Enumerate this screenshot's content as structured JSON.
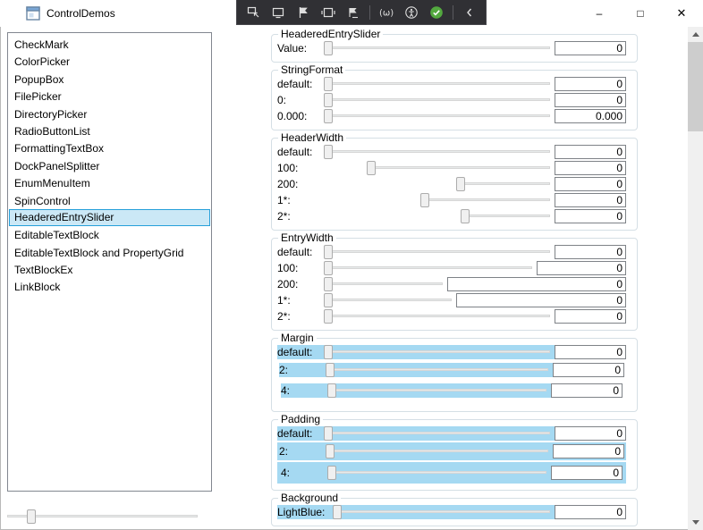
{
  "colors": {
    "selection-bg": "#CBE8F6",
    "selection-border": "#26A0DA",
    "highlight-row": "#A5D9F2",
    "group-border": "#D5DFE5",
    "entry-border": "#7E8287",
    "track-fill": "#E7EAEA",
    "track-border": "#D6D6D6",
    "thumb-fill": "#F0F0F0",
    "thumb-border": "#ACACAC",
    "toolbar-bg": "#303034",
    "toolbar-border": "#46464B",
    "toolbar-icon": "#DEDEDE",
    "status-green": "#53A93F",
    "scrollbar-bg": "#F0F0F0",
    "scrollbar-thumb": "#CDCDCD",
    "scrollbar-arrow": "#606060",
    "listbox-border": "#828790"
  },
  "window": {
    "title": "ControlDemos",
    "buttons": {
      "minimize": "–",
      "maximize": "□",
      "close": "✕"
    }
  },
  "debug_toolbar": {
    "items": [
      {
        "icon": "go-to-live-visual-tree-icon"
      },
      {
        "icon": "select-element-icon"
      },
      {
        "icon": "enable-selection-icon"
      },
      {
        "icon": "display-layout-adorners-icon"
      },
      {
        "icon": "track-focused-element-icon"
      },
      {
        "type": "separator"
      },
      {
        "icon": "hot-reload-icon"
      },
      {
        "icon": "accessibility-checker-icon"
      },
      {
        "icon": "status-ok-icon"
      },
      {
        "type": "separator"
      },
      {
        "icon": "collapse-toolbar-icon"
      }
    ]
  },
  "sidebar": {
    "items": [
      "CheckMark",
      "ColorPicker",
      "PopupBox",
      "FilePicker",
      "DirectoryPicker",
      "RadioButtonList",
      "FormattingTextBox",
      "DockPanelSplitter",
      "EnumMenuItem",
      "SpinControl",
      "HeaderedEntrySlider",
      "EditableTextBlock",
      "EditableTextBlock and PropertyGrid",
      "TextBlockEx",
      "LinkBlock"
    ],
    "selected_index": 10
  },
  "panel": {
    "groups": [
      {
        "title": "HeaderedEntrySlider",
        "rows": [
          {
            "label": "Value:",
            "value": "0"
          }
        ]
      },
      {
        "title": "StringFormat",
        "rows": [
          {
            "label": "default:",
            "value": "0"
          },
          {
            "label": "0:",
            "value": "0"
          },
          {
            "label": "0.000:",
            "value": "0.000"
          }
        ]
      },
      {
        "title": "HeaderWidth",
        "rows": [
          {
            "label": "default:",
            "value": "0"
          },
          {
            "label": "100:",
            "value": "0",
            "label_width": 100
          },
          {
            "label": "200:",
            "value": "0",
            "label_width": 200
          },
          {
            "label": "1*:",
            "value": "0",
            "label_width": 160
          },
          {
            "label": "2*:",
            "value": "0",
            "label_width": 205
          }
        ]
      },
      {
        "title": "EntryWidth",
        "rows": [
          {
            "label": "default:",
            "value": "0"
          },
          {
            "label": "100:",
            "value": "0",
            "entry_width": 100
          },
          {
            "label": "200:",
            "value": "0",
            "entry_width": 200
          },
          {
            "label": "1*:",
            "value": "0",
            "entry_width": 190
          },
          {
            "label": "2*:",
            "value": "0"
          }
        ]
      },
      {
        "title": "Margin",
        "rows": [
          {
            "label": "default:",
            "value": "0",
            "highlight": true,
            "margin": 0
          },
          {
            "label": "2:",
            "value": "0",
            "highlight": true,
            "margin": 2
          },
          {
            "label": "4:",
            "value": "0",
            "highlight": true,
            "margin": 4
          }
        ]
      },
      {
        "title": "Padding",
        "rows": [
          {
            "label": "default:",
            "value": "0",
            "highlight": true,
            "padding": 0
          },
          {
            "label": "2:",
            "value": "0",
            "highlight": true,
            "padding": 2
          },
          {
            "label": "4:",
            "value": "0",
            "highlight": true,
            "padding": 4
          }
        ]
      },
      {
        "title": "Background",
        "rows": [
          {
            "label": "LightBlue:",
            "value": "0",
            "highlight": true,
            "label_width": 62
          }
        ]
      }
    ]
  }
}
